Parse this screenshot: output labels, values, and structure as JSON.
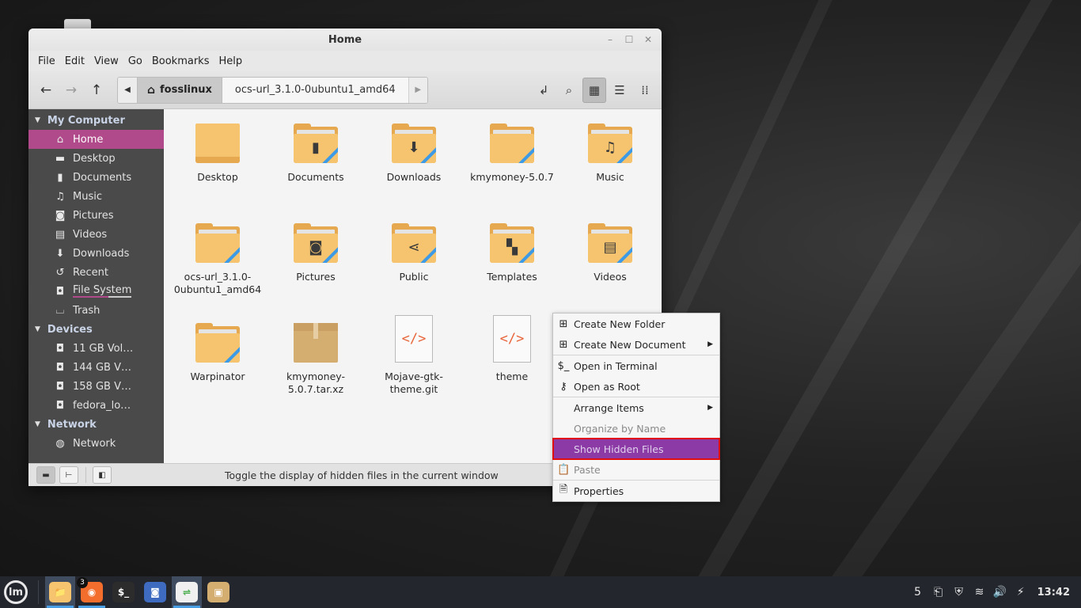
{
  "window": {
    "title": "Home",
    "controls": {
      "minimize": "–",
      "maximize": "☐",
      "close": "✕"
    }
  },
  "menubar": [
    "File",
    "Edit",
    "View",
    "Go",
    "Bookmarks",
    "Help"
  ],
  "toolbar": {
    "back_icon": "←",
    "forward_icon": "→",
    "up_icon": "↑",
    "path_left_icon": "◀",
    "path_right_icon": "▶",
    "home_icon": "⌂",
    "crumbs": [
      "fosslinux",
      "ocs-url_3.1.0-0ubuntu1_amd64"
    ],
    "toggle_location_icon": "↲",
    "search_icon": "⌕",
    "icon_view_icon": "▦",
    "list_view_icon": "☰",
    "compact_view_icon": "⁞⁞",
    "active_view": "icon"
  },
  "sidebar": {
    "sections": [
      {
        "title": "My Computer",
        "items": [
          {
            "label": "Home",
            "icon": "⌂",
            "selected": true
          },
          {
            "label": "Desktop",
            "icon": "▬"
          },
          {
            "label": "Documents",
            "icon": "▮"
          },
          {
            "label": "Music",
            "icon": "♫"
          },
          {
            "label": "Pictures",
            "icon": "◙"
          },
          {
            "label": "Videos",
            "icon": "▤"
          },
          {
            "label": "Downloads",
            "icon": "⬇"
          },
          {
            "label": "Recent",
            "icon": "↺"
          },
          {
            "label": "File System",
            "icon": "◘"
          },
          {
            "label": "Trash",
            "icon": "⌴"
          }
        ]
      },
      {
        "title": "Devices",
        "items": [
          {
            "label": "11 GB Vol…",
            "icon": "◘"
          },
          {
            "label": "144 GB V…",
            "icon": "◘"
          },
          {
            "label": "158 GB V…",
            "icon": "◘"
          },
          {
            "label": "fedora_lo…",
            "icon": "◘"
          }
        ]
      },
      {
        "title": "Network",
        "items": [
          {
            "label": "Network",
            "icon": "◍"
          }
        ]
      }
    ]
  },
  "files": [
    {
      "name": "Desktop",
      "type": "folder-plain",
      "emblem": ""
    },
    {
      "name": "Documents",
      "type": "folder",
      "emblem": "▮"
    },
    {
      "name": "Downloads",
      "type": "folder",
      "emblem": "⬇"
    },
    {
      "name": "kmymoney-5.0.7",
      "type": "folder",
      "emblem": ""
    },
    {
      "name": "Music",
      "type": "folder",
      "emblem": "♫"
    },
    {
      "name": "ocs-url_3.1.0-0ubuntu1_amd64",
      "type": "folder",
      "emblem": ""
    },
    {
      "name": "Pictures",
      "type": "folder",
      "emblem": "◙"
    },
    {
      "name": "Public",
      "type": "folder",
      "emblem": "⋖"
    },
    {
      "name": "Templates",
      "type": "folder",
      "emblem": "▚"
    },
    {
      "name": "Videos",
      "type": "folder",
      "emblem": "▤"
    },
    {
      "name": "Warpinator",
      "type": "folder",
      "emblem": ""
    },
    {
      "name": "kmymoney-5.0.7.tar.xz",
      "type": "archive",
      "emblem": ""
    },
    {
      "name": "Mojave-gtk-theme.git",
      "type": "code",
      "emblem": "</>"
    },
    {
      "name": "theme",
      "type": "code",
      "emblem": "</>"
    }
  ],
  "context_menu": [
    {
      "label": "Create New Folder",
      "icon": "⊞",
      "submenu": false,
      "disabled": false
    },
    {
      "label": "Create New Document",
      "icon": "⊞",
      "submenu": true,
      "disabled": false
    },
    {
      "separator": true
    },
    {
      "label": "Open in Terminal",
      "icon": "$_",
      "submenu": false,
      "disabled": false
    },
    {
      "label": "Open as Root",
      "icon": "⚷",
      "submenu": false,
      "disabled": false
    },
    {
      "separator": true
    },
    {
      "label": "Arrange Items",
      "icon": "",
      "submenu": true,
      "disabled": false
    },
    {
      "label": "Organize by Name",
      "icon": "",
      "submenu": false,
      "disabled": true
    },
    {
      "label": "Show Hidden Files",
      "icon": "",
      "submenu": false,
      "disabled": false,
      "highlighted": true
    },
    {
      "label": "Paste",
      "icon": "📋",
      "submenu": false,
      "disabled": true
    },
    {
      "separator": true
    },
    {
      "label": "Properties",
      "icon": "🗎",
      "submenu": false,
      "disabled": false
    }
  ],
  "statusbar": {
    "places_icon": "▬",
    "tree_icon": "⊢",
    "toggle_sidebar_icon": "◧",
    "text": "Toggle the display of hidden files in the current window"
  },
  "taskbar": {
    "menu_icon": "lm",
    "apps": [
      {
        "name": "Files",
        "icon": "📁",
        "color": "#f6c46e",
        "state": "focused"
      },
      {
        "name": "Firefox",
        "icon": "◉",
        "color": "#f36e2c",
        "badge": "3",
        "state": "running"
      },
      {
        "name": "Terminal",
        "icon": "$_",
        "color": "#2c2c2c",
        "state": ""
      },
      {
        "name": "Screenshot",
        "icon": "◙",
        "color": "#3e6bbf",
        "state": ""
      },
      {
        "name": "Settings",
        "icon": "⇌",
        "color": "#f0f0f0",
        "state": "running-focused"
      },
      {
        "name": "Archive",
        "icon": "▣",
        "color": "#d4ad71",
        "state": ""
      }
    ],
    "tray": [
      "5",
      "⎗",
      "⛨",
      "≋",
      "🔊",
      "⚡"
    ],
    "clock": "13:42"
  },
  "colors": {
    "selection": "#b04a8a",
    "menu_highlight": "#8b3aa6",
    "highlight_outline": "#e01010",
    "folder": "#f6c46e",
    "accent_blue": "#3d9ae6"
  }
}
